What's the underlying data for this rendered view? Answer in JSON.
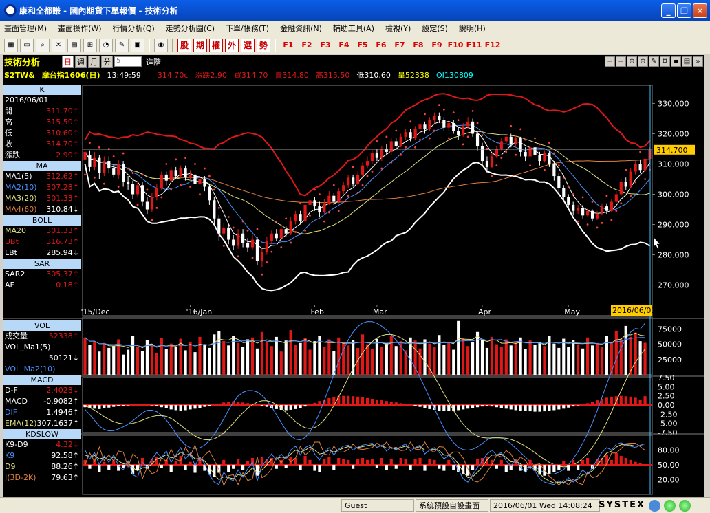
{
  "window": {
    "title": "康和全都賺 - 國內期貨下單報價 - 技術分析"
  },
  "menu": [
    "畫面管理(M)",
    "畫面操作(W)",
    "行情分析(Q)",
    "走勢分析圖(C)",
    "下單/帳務(T)",
    "金融資訊(N)",
    "輔助工具(A)",
    "檢視(Y)",
    "設定(S)",
    "說明(H)"
  ],
  "toolbar": {
    "quick": [
      "股",
      "期",
      "權",
      "外",
      "選",
      "勢"
    ],
    "fkeys": [
      "F1",
      "F2",
      "F3",
      "F4",
      "F5",
      "F6",
      "F7",
      "F8",
      "F9",
      "F10",
      "F11",
      "F12"
    ]
  },
  "header": {
    "title": "技術分析",
    "periods": [
      "日",
      "週",
      "月",
      "分"
    ],
    "minute_value": "5",
    "period_label": "進階"
  },
  "quote": {
    "symbol": "S2TW&",
    "name": "摩台指1606(日)",
    "time": "13:49:59",
    "price": "314.70c",
    "change": "漲跌2.90",
    "bid": "買314.70",
    "ask": "賣314.80",
    "high": "高315.50",
    "low": "低310.60",
    "volume": "量52338",
    "oi": "OI130809"
  },
  "info": {
    "k_head": "K",
    "date": "2016/06/01",
    "k": [
      {
        "l": "開",
        "v": "311.70↑"
      },
      {
        "l": "高",
        "v": "315.50↑"
      },
      {
        "l": "低",
        "v": "310.60↑"
      },
      {
        "l": "收",
        "v": "314.70↑"
      },
      {
        "l": "漲跌",
        "v": "2.90↑"
      }
    ],
    "ma_head": "MA",
    "ma": [
      {
        "l": "MA1(5)",
        "v": "312.62↑"
      },
      {
        "l": "MA2(10)",
        "v": "307.28↑"
      },
      {
        "l": "MA3(20)",
        "v": "301.33↑"
      },
      {
        "l": "MA4(60)",
        "v": "310.84↓"
      }
    ],
    "boll_head": "BOLL",
    "boll": [
      {
        "l": "MA20",
        "v": "301.33↑"
      },
      {
        "l": "UBt",
        "v": "316.73↑"
      },
      {
        "l": "LBt",
        "v": "285.94↓"
      }
    ],
    "sar_head": "SAR",
    "sar": [
      {
        "l": "SAR2",
        "v": "305.37↑"
      },
      {
        "l": "AF",
        "v": "0.18↑"
      }
    ],
    "vol_head": "VOL",
    "vol": [
      {
        "l": "成交量",
        "v": "52338↑"
      },
      {
        "l": "VOL_Ma1(5)",
        "v": ""
      },
      {
        "l": "",
        "v": "50121↓"
      },
      {
        "l": "VOL_Ma2(10)",
        "v": ""
      }
    ],
    "macd_head": "MACD",
    "macd": [
      {
        "l": "D-F",
        "v": "2.4028↓"
      },
      {
        "l": "MACD",
        "v": "-0.9082↑"
      },
      {
        "l": "DIF",
        "v": "1.4946↑"
      },
      {
        "l": "EMA(12)",
        "v": "307.1637↑"
      }
    ],
    "kd_head": "KDSLOW",
    "kd": [
      {
        "l": "K9-D9",
        "v": "4.32↓"
      },
      {
        "l": "K9",
        "v": "92.58↑"
      },
      {
        "l": "D9",
        "v": "88.26↑"
      },
      {
        "l": "J(3D-2K)",
        "v": "79.63↑"
      }
    ]
  },
  "axes": {
    "price_ticks": [
      "330.000",
      "320.000",
      "310.000",
      "300.000",
      "290.000",
      "280.000",
      "270.000"
    ],
    "current_price": "314.700",
    "x_labels": [
      "'15/Dec",
      "'16/Jan",
      "Feb",
      "Mar",
      "Apr",
      "May"
    ],
    "current_date": "2016/06/01",
    "vol_ticks": [
      "75000",
      "50000",
      "25000"
    ],
    "macd_ticks": [
      "7.50",
      "5.00",
      "2.50",
      "0.00",
      "-2.50",
      "-5.00",
      "-7.50"
    ],
    "kd_ticks": [
      "80.00",
      "50.00",
      "20.00"
    ]
  },
  "status": {
    "user": "Guest",
    "screen": "系統預設自設畫面",
    "datetime": "2016/06/01 Wed 14:08:24",
    "brand": "SYSTEX"
  },
  "colors": {
    "up": "#e01818",
    "down": "#ffffff",
    "boll_upper": "#e01818",
    "boll_lower": "#ffffff",
    "ma5": "#ffffff",
    "ma10": "#4a90ff",
    "ma20": "#e0e080",
    "ma60": "#e08040",
    "sar": "#ff4040",
    "bg": "#000000"
  },
  "chart_data": {
    "type": "candlestick",
    "y_range": [
      264,
      336
    ],
    "candles": [
      [
        311.5,
        314.0,
        315.5,
        309.0
      ],
      [
        313.0,
        309.0,
        314.5,
        307.5
      ],
      [
        309.0,
        312.0,
        314.0,
        308.0
      ],
      [
        312.0,
        307.0,
        313.0,
        305.0
      ],
      [
        307.0,
        311.0,
        312.5,
        306.0
      ],
      [
        311.0,
        308.5,
        312.5,
        307.0
      ],
      [
        308.5,
        306.5,
        310.0,
        305.5
      ],
      [
        306.5,
        310.0,
        311.5,
        305.0
      ],
      [
        310.0,
        304.0,
        311.0,
        302.5
      ],
      [
        304.0,
        303.5,
        306.0,
        301.5
      ],
      [
        303.5,
        300.0,
        304.5,
        298.5
      ],
      [
        300.0,
        303.0,
        304.0,
        299.0
      ],
      [
        303.0,
        297.5,
        304.0,
        296.0
      ],
      [
        297.5,
        295.0,
        299.0,
        293.5
      ],
      [
        295.0,
        299.0,
        300.5,
        294.0
      ],
      [
        299.0,
        302.0,
        303.5,
        298.0
      ],
      [
        302.0,
        306.5,
        307.5,
        301.5
      ],
      [
        306.5,
        304.5,
        307.5,
        303.0
      ],
      [
        304.5,
        308.0,
        309.0,
        304.0
      ],
      [
        308.0,
        306.0,
        309.0,
        305.0
      ],
      [
        306.0,
        308.5,
        309.5,
        305.5
      ],
      [
        308.5,
        305.5,
        309.5,
        304.5
      ],
      [
        305.5,
        306.5,
        308.0,
        305.0
      ],
      [
        306.5,
        303.5,
        307.5,
        302.5
      ],
      [
        303.5,
        305.0,
        306.5,
        302.5
      ],
      [
        305.0,
        302.5,
        306.0,
        301.0
      ],
      [
        302.5,
        298.0,
        303.5,
        296.5
      ],
      [
        298.0,
        292.0,
        299.0,
        290.0
      ],
      [
        292.0,
        287.0,
        293.0,
        284.5
      ],
      [
        287.0,
        289.0,
        290.5,
        285.5
      ],
      [
        289.0,
        285.0,
        290.0,
        283.5
      ],
      [
        285.0,
        283.0,
        286.5,
        281.5
      ],
      [
        283.0,
        287.0,
        288.5,
        282.0
      ],
      [
        287.0,
        284.0,
        288.5,
        282.5
      ],
      [
        284.0,
        282.5,
        285.5,
        281.0
      ],
      [
        282.5,
        285.0,
        286.5,
        281.5
      ],
      [
        285.0,
        278.0,
        286.0,
        276.5
      ],
      [
        278.0,
        281.0,
        282.0,
        276.0
      ],
      [
        281.0,
        284.5,
        286.0,
        280.0
      ],
      [
        284.5,
        287.0,
        288.0,
        283.5
      ],
      [
        287.0,
        285.5,
        288.5,
        284.5
      ],
      [
        285.5,
        288.5,
        290.0,
        285.0
      ],
      [
        288.5,
        287.0,
        289.5,
        286.0
      ],
      [
        287.0,
        291.0,
        292.5,
        286.5
      ],
      [
        291.0,
        293.5,
        294.5,
        290.0
      ],
      [
        293.5,
        291.0,
        294.5,
        290.0
      ],
      [
        291.0,
        296.5,
        298.0,
        290.5
      ],
      [
        296.5,
        298.0,
        299.5,
        295.5
      ],
      [
        298.0,
        296.0,
        299.0,
        294.5
      ],
      [
        296.0,
        294.0,
        297.5,
        292.5
      ],
      [
        294.0,
        297.0,
        298.5,
        293.5
      ],
      [
        297.0,
        299.5,
        301.0,
        296.5
      ],
      [
        299.5,
        297.5,
        300.5,
        296.5
      ],
      [
        297.5,
        301.0,
        302.0,
        297.0
      ],
      [
        301.0,
        303.0,
        304.0,
        300.0
      ],
      [
        303.0,
        305.5,
        306.5,
        302.0
      ],
      [
        305.5,
        303.5,
        306.5,
        302.5
      ],
      [
        303.5,
        306.5,
        307.5,
        303.0
      ],
      [
        306.5,
        309.5,
        310.5,
        305.5
      ],
      [
        309.5,
        311.0,
        312.5,
        308.5
      ],
      [
        311.0,
        313.5,
        314.5,
        310.0
      ],
      [
        313.5,
        312.0,
        315.0,
        311.0
      ],
      [
        312.0,
        315.0,
        316.0,
        311.0
      ],
      [
        315.0,
        314.0,
        316.5,
        313.0
      ],
      [
        314.0,
        317.5,
        318.5,
        313.0
      ],
      [
        317.5,
        316.0,
        318.5,
        315.0
      ],
      [
        316.0,
        319.0,
        320.0,
        315.5
      ],
      [
        319.0,
        320.5,
        321.5,
        318.0
      ],
      [
        320.5,
        318.5,
        321.5,
        317.5
      ],
      [
        318.5,
        321.5,
        322.5,
        318.0
      ],
      [
        321.5,
        323.0,
        324.0,
        320.5
      ],
      [
        323.0,
        321.5,
        324.0,
        320.0
      ],
      [
        321.5,
        324.5,
        325.5,
        321.0
      ],
      [
        324.5,
        326.0,
        327.0,
        323.5
      ],
      [
        326.0,
        324.5,
        327.0,
        323.5
      ],
      [
        324.5,
        322.0,
        325.5,
        321.0
      ],
      [
        322.0,
        323.5,
        324.5,
        321.0
      ],
      [
        323.5,
        321.0,
        324.5,
        320.0
      ],
      [
        321.0,
        319.5,
        322.0,
        318.0
      ],
      [
        319.5,
        322.5,
        323.5,
        319.0
      ],
      [
        322.5,
        324.0,
        325.5,
        321.5
      ],
      [
        324.0,
        320.0,
        325.0,
        319.0
      ],
      [
        320.0,
        316.0,
        321.0,
        314.5
      ],
      [
        316.0,
        311.0,
        317.0,
        309.5
      ],
      [
        311.0,
        309.0,
        312.5,
        307.0
      ],
      [
        309.0,
        312.5,
        313.5,
        308.5
      ],
      [
        312.5,
        315.0,
        316.0,
        312.0
      ],
      [
        315.0,
        317.5,
        318.5,
        314.5
      ],
      [
        317.5,
        319.0,
        320.0,
        316.5
      ],
      [
        319.0,
        316.5,
        320.0,
        315.5
      ],
      [
        316.5,
        318.5,
        319.5,
        315.5
      ],
      [
        318.5,
        314.0,
        319.0,
        312.5
      ],
      [
        314.0,
        312.5,
        315.5,
        311.0
      ],
      [
        312.5,
        315.5,
        316.5,
        312.0
      ],
      [
        315.5,
        313.0,
        316.0,
        311.5
      ],
      [
        313.0,
        311.0,
        314.0,
        309.5
      ],
      [
        311.0,
        313.5,
        314.5,
        310.5
      ],
      [
        313.5,
        310.0,
        314.5,
        309.0
      ],
      [
        310.0,
        306.0,
        311.0,
        304.5
      ],
      [
        306.0,
        302.0,
        307.0,
        300.5
      ],
      [
        302.0,
        299.0,
        303.0,
        297.5
      ],
      [
        299.0,
        296.5,
        300.0,
        295.0
      ],
      [
        296.5,
        294.5,
        297.5,
        293.0
      ],
      [
        294.5,
        295.5,
        296.5,
        293.5
      ],
      [
        295.5,
        293.0,
        296.5,
        292.0
      ],
      [
        293.0,
        294.5,
        295.5,
        292.5
      ],
      [
        294.5,
        292.0,
        295.0,
        291.0
      ],
      [
        292.0,
        293.5,
        294.5,
        291.5
      ],
      [
        293.5,
        296.0,
        297.0,
        293.0
      ],
      [
        296.0,
        294.5,
        297.0,
        293.5
      ],
      [
        294.5,
        297.5,
        298.5,
        294.0
      ],
      [
        297.5,
        300.0,
        301.0,
        297.0
      ],
      [
        300.0,
        304.0,
        305.0,
        299.5
      ],
      [
        304.0,
        302.5,
        305.5,
        301.5
      ],
      [
        302.5,
        307.5,
        308.5,
        302.0
      ],
      [
        307.5,
        310.0,
        311.0,
        306.5
      ],
      [
        310.0,
        308.0,
        311.5,
        307.0
      ],
      [
        308.0,
        311.7,
        312.5,
        307.5
      ],
      [
        311.7,
        314.7,
        315.5,
        310.6
      ]
    ],
    "volume": [
      61000,
      49000,
      55000,
      38000,
      52000,
      44000,
      47000,
      58000,
      33000,
      41000,
      63000,
      45000,
      39000,
      57000,
      48000,
      36000,
      60000,
      42000,
      51000,
      46000,
      59000,
      40000,
      53000,
      37000,
      62000,
      50000,
      44000,
      66000,
      71000,
      55000,
      48000,
      63000,
      52000,
      45000,
      58000,
      61000,
      43000,
      70000,
      54000,
      47000,
      62000,
      38000,
      56000,
      73000,
      49000,
      52000,
      60000,
      41000,
      55000,
      64000,
      46000,
      58000,
      39000,
      61000,
      53000,
      48000,
      57000,
      44000,
      66000,
      50000,
      42000,
      59000,
      45000,
      52000,
      63000,
      47000,
      55000,
      40000,
      61000,
      56000,
      43000,
      58000,
      51000,
      46000,
      65000,
      49000,
      54000,
      41000,
      88000,
      60000,
      47000,
      53000,
      70000,
      57000,
      44000,
      62000,
      50000,
      45000,
      58000,
      48000,
      55000,
      61000,
      42000,
      56000,
      49000,
      53000,
      47000,
      64000,
      51000,
      44000,
      59000,
      46000,
      57000,
      50000,
      43000,
      61000,
      48000,
      52000,
      45000,
      63000,
      54000,
      72000,
      58000,
      80000,
      62000,
      69000,
      55000,
      52338
    ],
    "macd_hist": [
      -0.6,
      -0.8,
      -1.0,
      -1.1,
      -0.9,
      -0.7,
      -0.5,
      -0.3,
      -0.2,
      -0.1,
      0.1,
      0.2,
      0.3,
      0.2,
      -0.1,
      -0.3,
      -0.6,
      -0.9,
      -1.2,
      -1.4,
      -1.5,
      -1.4,
      -1.2,
      -1.0,
      -0.8,
      -0.5,
      -0.2,
      0.1,
      0.4,
      0.7,
      0.9,
      1.0,
      0.9,
      0.7,
      0.5,
      0.3,
      0.1,
      -0.2,
      -0.5,
      -0.8,
      -1.1,
      -1.3,
      -1.4,
      -1.3,
      -1.1,
      -0.8,
      -0.4,
      0.1,
      0.6,
      1.1,
      1.5,
      1.9,
      2.2,
      2.4,
      2.5,
      2.5,
      2.4,
      2.3,
      2.1,
      1.9,
      1.7,
      1.5,
      1.3,
      1.1,
      0.9,
      0.7,
      0.5,
      0.3,
      0.1,
      -0.2,
      -0.5,
      -0.8,
      -1.1,
      -1.3,
      -1.5,
      -1.6,
      -1.6,
      -1.5,
      -1.4,
      -1.2,
      -1.0,
      -0.8,
      -0.6,
      -0.4,
      -0.3,
      -0.4,
      -0.6,
      -0.8,
      -1.0,
      -1.2,
      -1.4,
      -1.5,
      -1.6,
      -1.7,
      -1.8,
      -1.8,
      -1.7,
      -1.6,
      -1.4,
      -1.2,
      -1.0,
      -0.7,
      -0.4,
      -0.1,
      0.2,
      0.5,
      0.9,
      1.3,
      1.7,
      2.0,
      2.2,
      2.4,
      2.5,
      2.4,
      2.3,
      2.0,
      1.5,
      2.4
    ],
    "kd_hist": [
      10,
      -8,
      12,
      -14,
      6,
      -10,
      9,
      -12,
      -6,
      8,
      -18,
      -10,
      14,
      -8,
      12,
      16,
      -6,
      10,
      -14,
      8,
      18,
      -10,
      6,
      -16,
      12,
      -12,
      -20,
      -24,
      -16,
      10,
      -14,
      -8,
      12,
      -10,
      8,
      14,
      -22,
      16,
      12,
      14,
      -8,
      10,
      -6,
      16,
      14,
      -10,
      18,
      10,
      -12,
      -14,
      12,
      16,
      -10,
      14,
      12,
      10,
      -8,
      12,
      14,
      10,
      12,
      -6,
      14,
      -10,
      12,
      -8,
      14,
      12,
      -10,
      12,
      14,
      -12,
      12,
      10,
      -8,
      -12,
      10,
      -10,
      -14,
      -18,
      -22,
      -10,
      12,
      14,
      16,
      10,
      -8,
      10,
      -14,
      -10,
      12,
      -12,
      -14,
      10,
      -12,
      -20,
      -22,
      -18,
      -14,
      -10,
      8,
      -12,
      10,
      -10,
      10,
      14,
      -8,
      12,
      14,
      20,
      10,
      24,
      18,
      14,
      10,
      6,
      4
    ],
    "kd_k": [
      80,
      62,
      75,
      50,
      68,
      55,
      70,
      48,
      40,
      58,
      30,
      25,
      55,
      45,
      62,
      75,
      65,
      78,
      55,
      70,
      85,
      62,
      74,
      48,
      66,
      52,
      30,
      15,
      10,
      35,
      22,
      18,
      40,
      25,
      42,
      55,
      18,
      48,
      60,
      72,
      60,
      72,
      62,
      80,
      88,
      70,
      85,
      90,
      72,
      60,
      75,
      85,
      70,
      82,
      88,
      90,
      80,
      86,
      90,
      92,
      94,
      85,
      90,
      78,
      86,
      80,
      88,
      92,
      78,
      85,
      90,
      72,
      80,
      85,
      75,
      62,
      70,
      58,
      40,
      22,
      15,
      30,
      45,
      58,
      72,
      80,
      70,
      75,
      58,
      48,
      60,
      45,
      35,
      48,
      38,
      22,
      15,
      12,
      10,
      18,
      12,
      24,
      15,
      25,
      40,
      30,
      45,
      60,
      75,
      85,
      80,
      92,
      95,
      90,
      88,
      85,
      90,
      92.58
    ],
    "kd_d": [
      70,
      66,
      69,
      62,
      65,
      60,
      66,
      58,
      52,
      54,
      44,
      38,
      44,
      45,
      52,
      62,
      65,
      71,
      64,
      67,
      76,
      70,
      72,
      62,
      63,
      58,
      46,
      30,
      20,
      26,
      24,
      22,
      30,
      28,
      34,
      44,
      34,
      40,
      50,
      62,
      62,
      66,
      64,
      72,
      80,
      76,
      80,
      86,
      80,
      72,
      74,
      80,
      76,
      80,
      84,
      87,
      84,
      85,
      87,
      89,
      91,
      88,
      89,
      84,
      85,
      82,
      85,
      88,
      84,
      84,
      87,
      80,
      80,
      82,
      79,
      70,
      70,
      64,
      52,
      36,
      24,
      26,
      35,
      46,
      60,
      70,
      70,
      72,
      65,
      56,
      58,
      52,
      43,
      46,
      42,
      32,
      23,
      17,
      13,
      15,
      14,
      19,
      17,
      21,
      30,
      32,
      38,
      49,
      62,
      74,
      78,
      86,
      91,
      91,
      90,
      88,
      89,
      88.26
    ]
  }
}
